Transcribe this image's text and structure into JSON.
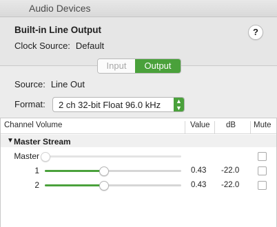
{
  "window": {
    "title": "Audio Devices"
  },
  "device": {
    "name": "Built-in Line Output",
    "clock_label": "Clock Source:",
    "clock_value": "Default",
    "help_label": "?"
  },
  "tabs": {
    "input": "Input",
    "output": "Output",
    "selected": "Output"
  },
  "source": {
    "label": "Source:",
    "value": "Line Out"
  },
  "format": {
    "label": "Format:",
    "value": "2 ch 32-bit Float 96.0 kHz"
  },
  "table": {
    "headers": {
      "channel": "Channel Volume",
      "value": "Value",
      "db": "dB",
      "mute": "Mute"
    },
    "group": "Master Stream",
    "rows": [
      {
        "name": "Master",
        "level": 0.0,
        "value": "",
        "db": "",
        "muted": false,
        "enabled": false
      },
      {
        "name": "1",
        "level": 0.43,
        "value": "0.43",
        "db": "-22.0",
        "muted": false,
        "enabled": true
      },
      {
        "name": "2",
        "level": 0.43,
        "value": "0.43",
        "db": "-22.0",
        "muted": false,
        "enabled": true
      }
    ]
  },
  "colors": {
    "accent": "#4aa13b"
  }
}
